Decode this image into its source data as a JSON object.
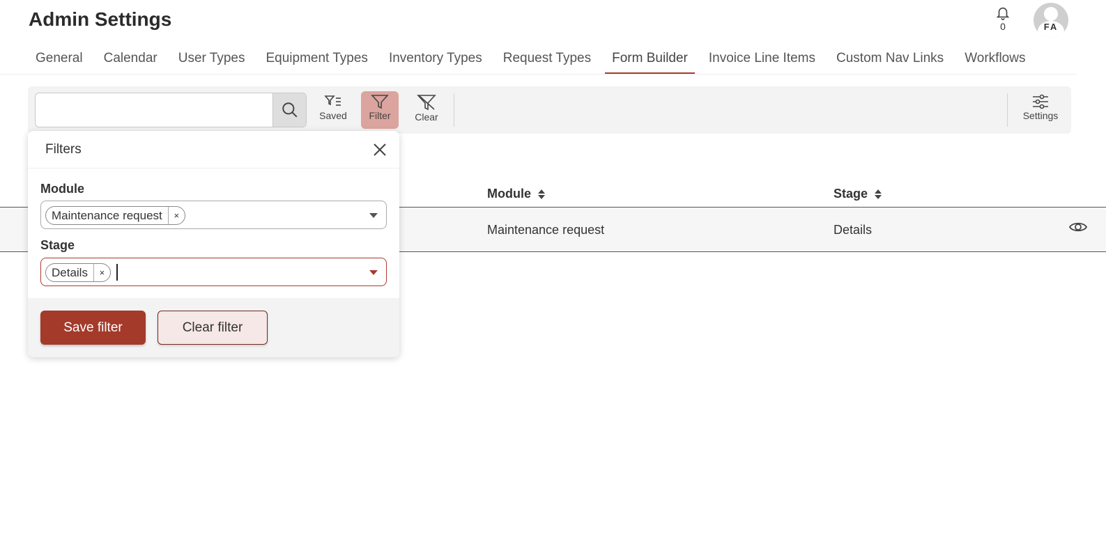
{
  "header": {
    "title": "Admin Settings",
    "notifications_count": "0",
    "avatar_initials": "FA"
  },
  "tabs": [
    {
      "label": "General"
    },
    {
      "label": "Calendar"
    },
    {
      "label": "User Types"
    },
    {
      "label": "Equipment Types"
    },
    {
      "label": "Inventory Types"
    },
    {
      "label": "Request Types"
    },
    {
      "label": "Form Builder",
      "active": true
    },
    {
      "label": "Invoice Line Items"
    },
    {
      "label": "Custom Nav Links"
    },
    {
      "label": "Workflows"
    }
  ],
  "toolbar": {
    "search_value": "",
    "saved_label": "Saved",
    "filter_label": "Filter",
    "clear_label": "Clear",
    "settings_label": "Settings"
  },
  "table": {
    "columns": [
      {
        "label": "Module"
      },
      {
        "label": "Stage"
      }
    ],
    "rows": [
      {
        "module": "Maintenance request",
        "stage": "Details"
      }
    ]
  },
  "filters": {
    "title": "Filters",
    "module_label": "Module",
    "module_selected": "Maintenance request",
    "stage_label": "Stage",
    "stage_selected": "Details",
    "remove_glyph": "×",
    "save_label": "Save filter",
    "clear_label": "Clear filter"
  },
  "colors": {
    "accent": "#a33a2a",
    "active_tab_underline": "#a93b2c",
    "filter_active_bg": "#dca49e"
  }
}
